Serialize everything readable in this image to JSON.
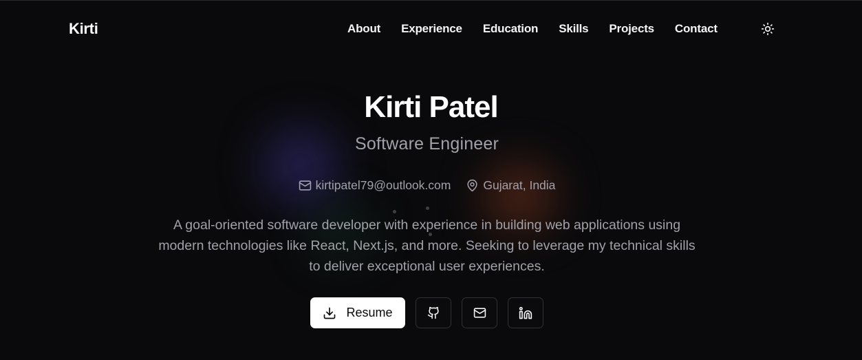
{
  "header": {
    "brand": "Kirti",
    "nav": [
      {
        "label": "About"
      },
      {
        "label": "Experience"
      },
      {
        "label": "Education"
      },
      {
        "label": "Skills"
      },
      {
        "label": "Projects"
      },
      {
        "label": "Contact"
      }
    ],
    "theme_icon": "sun-icon"
  },
  "hero": {
    "name": "Kirti Patel",
    "role": "Software Engineer",
    "email": "kirtipatel79@outlook.com",
    "location": "Gujarat, India",
    "bio": "A goal-oriented software developer with experience in building web applications using modern technologies like React, Next.js, and more. Seeking to leverage my technical skills to deliver exceptional user experiences.",
    "actions": {
      "resume_label": "Resume",
      "resume_icon": "download-icon",
      "github_icon": "github-icon",
      "mail_icon": "mail-icon",
      "linkedin_icon": "linkedin-icon"
    }
  },
  "colors": {
    "background": "#0a0a0c",
    "text_primary": "#ffffff",
    "text_muted": "#a1a1aa",
    "button_primary_bg": "#ffffff",
    "button_border": "#303036"
  }
}
